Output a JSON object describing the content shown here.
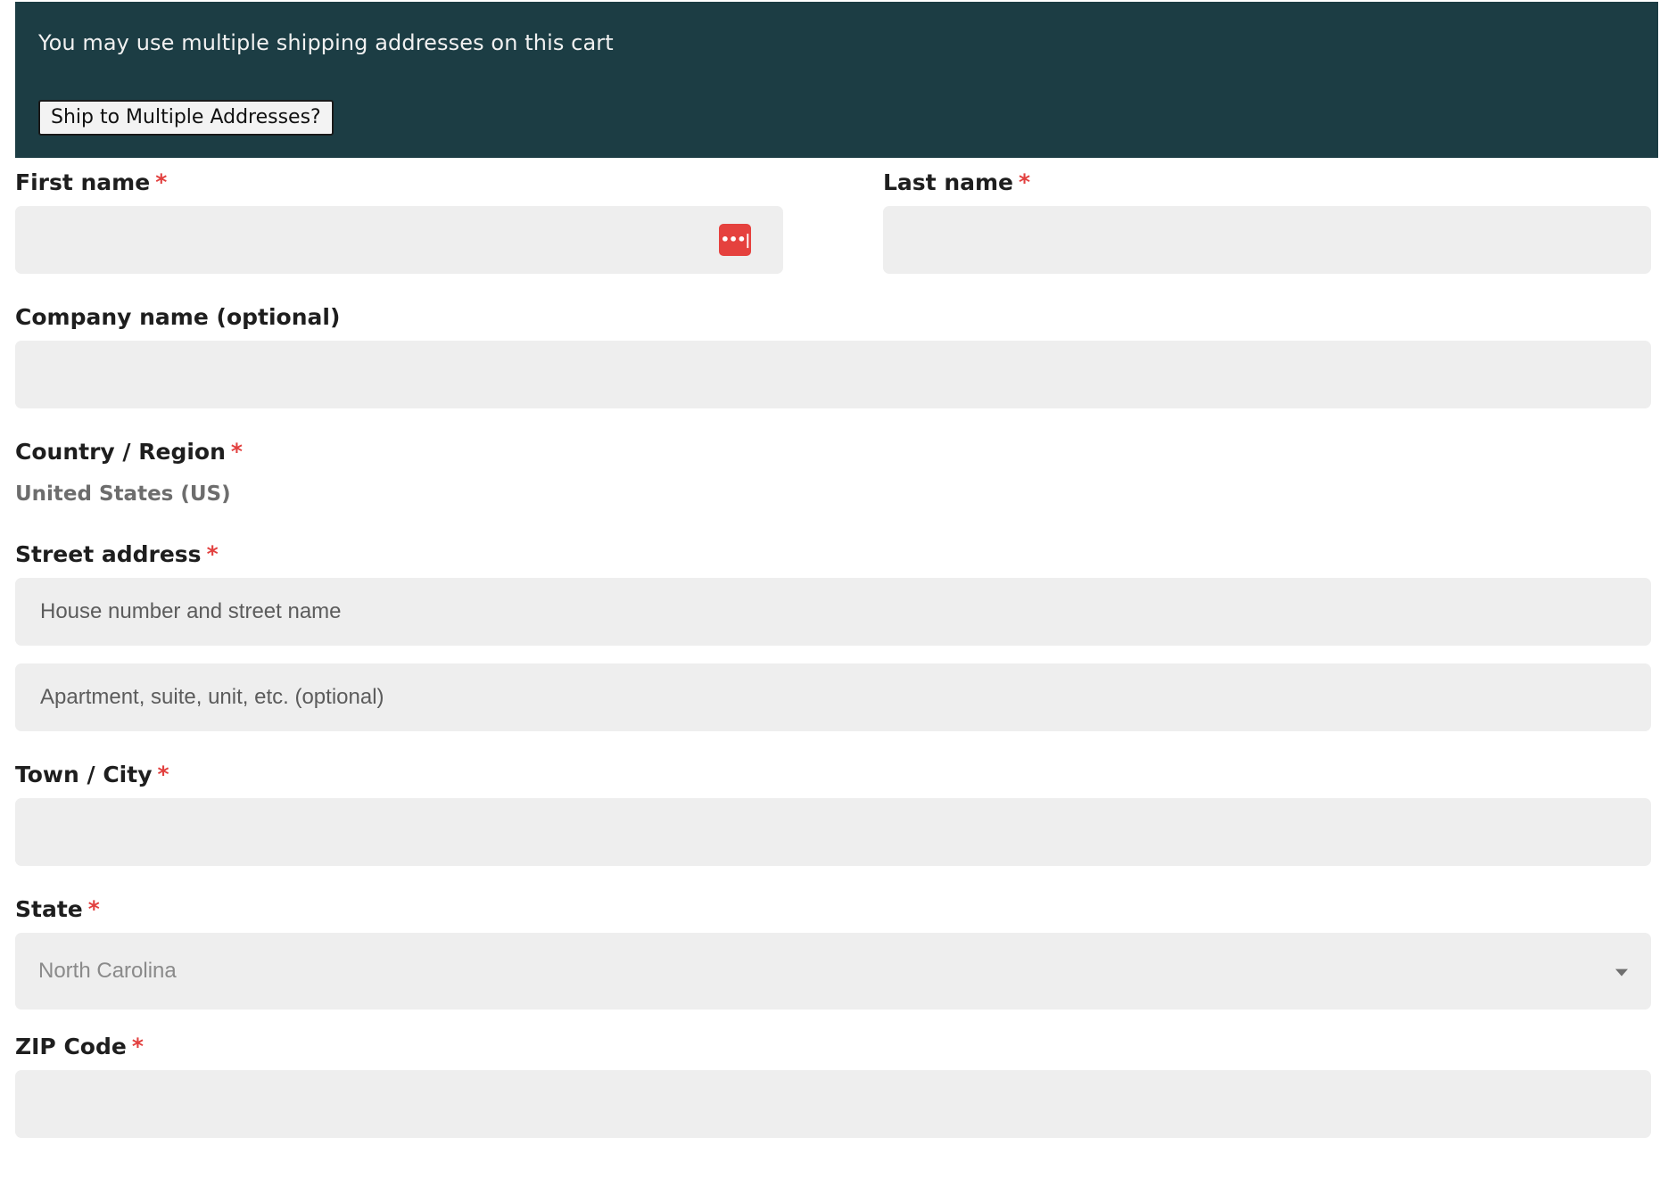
{
  "notice": {
    "text": "You may use multiple shipping addresses on this cart",
    "button_label": "Ship to Multiple Addresses?",
    "background_color": "#1c3d44"
  },
  "required_marker": "*",
  "required_color": "#e2403f",
  "form": {
    "first_name": {
      "label": "First name",
      "value": "",
      "icon": "password-manager-icon"
    },
    "last_name": {
      "label": "Last name",
      "value": ""
    },
    "company": {
      "label": "Company name (optional)",
      "value": ""
    },
    "country": {
      "label": "Country / Region",
      "value": "United States (US)"
    },
    "street": {
      "label": "Street address",
      "line1_placeholder": "House number and street name",
      "line2_placeholder": "Apartment, suite, unit, etc. (optional)"
    },
    "city": {
      "label": "Town / City",
      "value": ""
    },
    "state": {
      "label": "State",
      "selected": "North Carolina",
      "icon": "chevron-down-icon"
    },
    "zip": {
      "label": "ZIP Code",
      "value": ""
    }
  }
}
